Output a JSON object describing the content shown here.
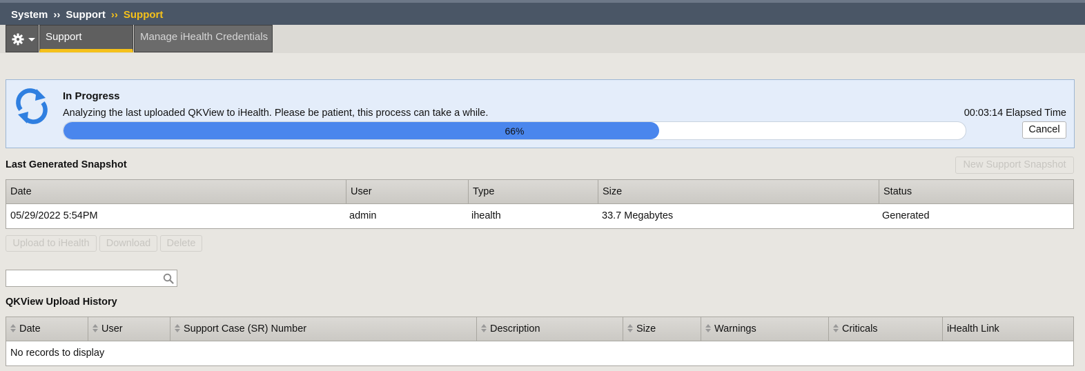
{
  "breadcrumb": {
    "items": [
      "System",
      "Support"
    ],
    "current": "Support",
    "separator": "››"
  },
  "tabs": {
    "active": "Support",
    "inactive": "Manage iHealth Credentials"
  },
  "progress": {
    "title": "In Progress",
    "message": "Analyzing the last uploaded QKView to iHealth. Please be patient, this process can take a while.",
    "elapsed_value": "00:03:14",
    "elapsed_label": "Elapsed Time",
    "percent": 66,
    "percent_text": "66%",
    "cancel_label": "Cancel"
  },
  "snapshot": {
    "title": "Last Generated Snapshot",
    "new_button": "New Support Snapshot",
    "columns": [
      "Date",
      "User",
      "Type",
      "Size",
      "Status"
    ],
    "row": {
      "date": "05/29/2022 5:54PM",
      "user": "admin",
      "type": "ihealth",
      "size": "33.7 Megabytes",
      "status": "Generated"
    },
    "actions": {
      "upload": "Upload to iHealth",
      "download": "Download",
      "delete": "Delete"
    }
  },
  "search": {
    "value": ""
  },
  "history": {
    "title": "QKView Upload History",
    "columns": [
      "Date",
      "User",
      "Support Case (SR) Number",
      "Description",
      "Size",
      "Warnings",
      "Criticals",
      "iHealth Link"
    ],
    "empty_text": "No records to display"
  },
  "colors": {
    "accent": "#f5c11a",
    "progress_fill": "#4a86ed",
    "panel_bg": "#e4edfa",
    "header_bg": "#4a5666"
  }
}
